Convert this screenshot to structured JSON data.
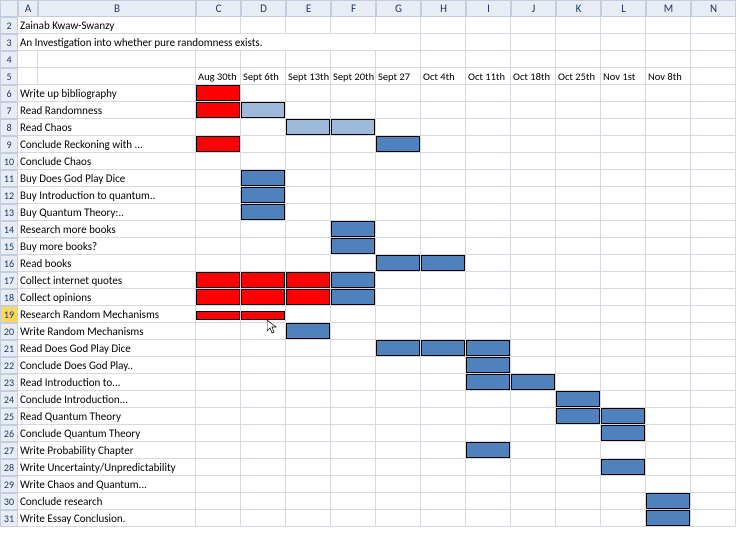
{
  "columns": [
    "A",
    "B",
    "C",
    "D",
    "E",
    "F",
    "G",
    "H",
    "I",
    "J",
    "K",
    "L",
    "M",
    "N"
  ],
  "author": "Zainab Kwaw-Swanzy",
  "topic": "An Investigation into whether pure randomness exists.",
  "dates": [
    "Aug 30th",
    "Sept 6th",
    "Sept 13th",
    "Sept 20th",
    "Sept 27",
    "Oct 4th",
    "Oct 11th",
    "Oct 18th",
    "Oct 25th",
    "Nov 1st",
    "Nov 8th"
  ],
  "selected_row": 19,
  "chart_data": {
    "type": "bar",
    "title": "An Investigation into whether pure randomness exists.",
    "xlabel": "",
    "ylabel": "",
    "categories": [
      "Aug 30th",
      "Sept 6th",
      "Sept 13th",
      "Sept 20th",
      "Sept 27",
      "Oct 4th",
      "Oct 11th",
      "Oct 18th",
      "Oct 25th",
      "Nov 1st",
      "Nov 8th"
    ],
    "series": [
      {
        "row": 6,
        "name": "Write up bibliography",
        "start": 0,
        "span": 1,
        "color": "red"
      },
      {
        "row": 7,
        "name": "Read Randomness",
        "start": 0,
        "span": 2,
        "color": "mixed_red_light",
        "segments": [
          {
            "s": 0,
            "c": "red"
          },
          {
            "s": 1,
            "c": "light"
          }
        ]
      },
      {
        "row": 8,
        "name": "Read Chaos",
        "start": 2,
        "span": 2,
        "color": "light"
      },
      {
        "row": 9,
        "name": "Conclude Reckoning with ...",
        "start": 0,
        "span": 1,
        "color": "red",
        "extra": [
          {
            "s": 4,
            "c": "blue"
          }
        ]
      },
      {
        "row": 10,
        "name": "Conclude Chaos",
        "start": null
      },
      {
        "row": 11,
        "name": "Buy Does God Play Dice",
        "start": 1,
        "span": 1,
        "color": "blue"
      },
      {
        "row": 12,
        "name": "Buy Introduction to quantum..",
        "start": 1,
        "span": 1,
        "color": "blue"
      },
      {
        "row": 13,
        "name": "Buy Quantum Theory:..",
        "start": 1,
        "span": 1,
        "color": "blue"
      },
      {
        "row": 14,
        "name": "Research more books",
        "start": 3,
        "span": 1,
        "color": "blue"
      },
      {
        "row": 15,
        "name": "Buy more books?",
        "start": 3,
        "span": 1,
        "color": "blue"
      },
      {
        "row": 16,
        "name": "Read books",
        "start": 4,
        "span": 2,
        "color": "blue"
      },
      {
        "row": 17,
        "name": "Collect internet quotes",
        "start": 0,
        "span": 4,
        "color": "mixed",
        "segments": [
          {
            "s": 0,
            "c": "red"
          },
          {
            "s": 1,
            "c": "red"
          },
          {
            "s": 2,
            "c": "red"
          },
          {
            "s": 3,
            "c": "blue"
          }
        ]
      },
      {
        "row": 18,
        "name": "Collect opinions",
        "start": 0,
        "span": 4,
        "color": "mixed",
        "segments": [
          {
            "s": 0,
            "c": "red"
          },
          {
            "s": 1,
            "c": "red"
          },
          {
            "s": 2,
            "c": "red"
          },
          {
            "s": 3,
            "c": "blue"
          }
        ]
      },
      {
        "row": 19,
        "name": "Research Random Mechanisms",
        "start": 0,
        "span": 2,
        "color": "mini"
      },
      {
        "row": 20,
        "name": "Write Random Mechanisms",
        "start": 2,
        "span": 1,
        "color": "blue"
      },
      {
        "row": 21,
        "name": "Read Does God Play Dice",
        "start": 4,
        "span": 3,
        "color": "blue"
      },
      {
        "row": 22,
        "name": "Conclude Does God Play..",
        "start": 6,
        "span": 1,
        "color": "blue"
      },
      {
        "row": 23,
        "name": "Read Introduction to...",
        "start": 6,
        "span": 2,
        "color": "blue"
      },
      {
        "row": 24,
        "name": "Conclude Introduction...",
        "start": 8,
        "span": 1,
        "color": "blue"
      },
      {
        "row": 25,
        "name": "Read Quantum Theory",
        "start": 8,
        "span": 2,
        "color": "blue"
      },
      {
        "row": 26,
        "name": "Conclude Quantum Theory",
        "start": 9,
        "span": 1,
        "color": "blue"
      },
      {
        "row": 27,
        "name": "Write Probability Chapter",
        "start": 6,
        "span": 1,
        "color": "blue"
      },
      {
        "row": 28,
        "name": "Write Uncertainty/Unpredictability",
        "start": 9,
        "span": 1,
        "color": "blue"
      },
      {
        "row": 29,
        "name": "Write Chaos and Quantum...",
        "start": null
      },
      {
        "row": 30,
        "name": "Conclude research",
        "start": 10,
        "span": 1,
        "color": "blue"
      },
      {
        "row": 31,
        "name": "Write Essay Conclusion.",
        "start": 10,
        "span": 1,
        "color": "blue"
      }
    ]
  }
}
